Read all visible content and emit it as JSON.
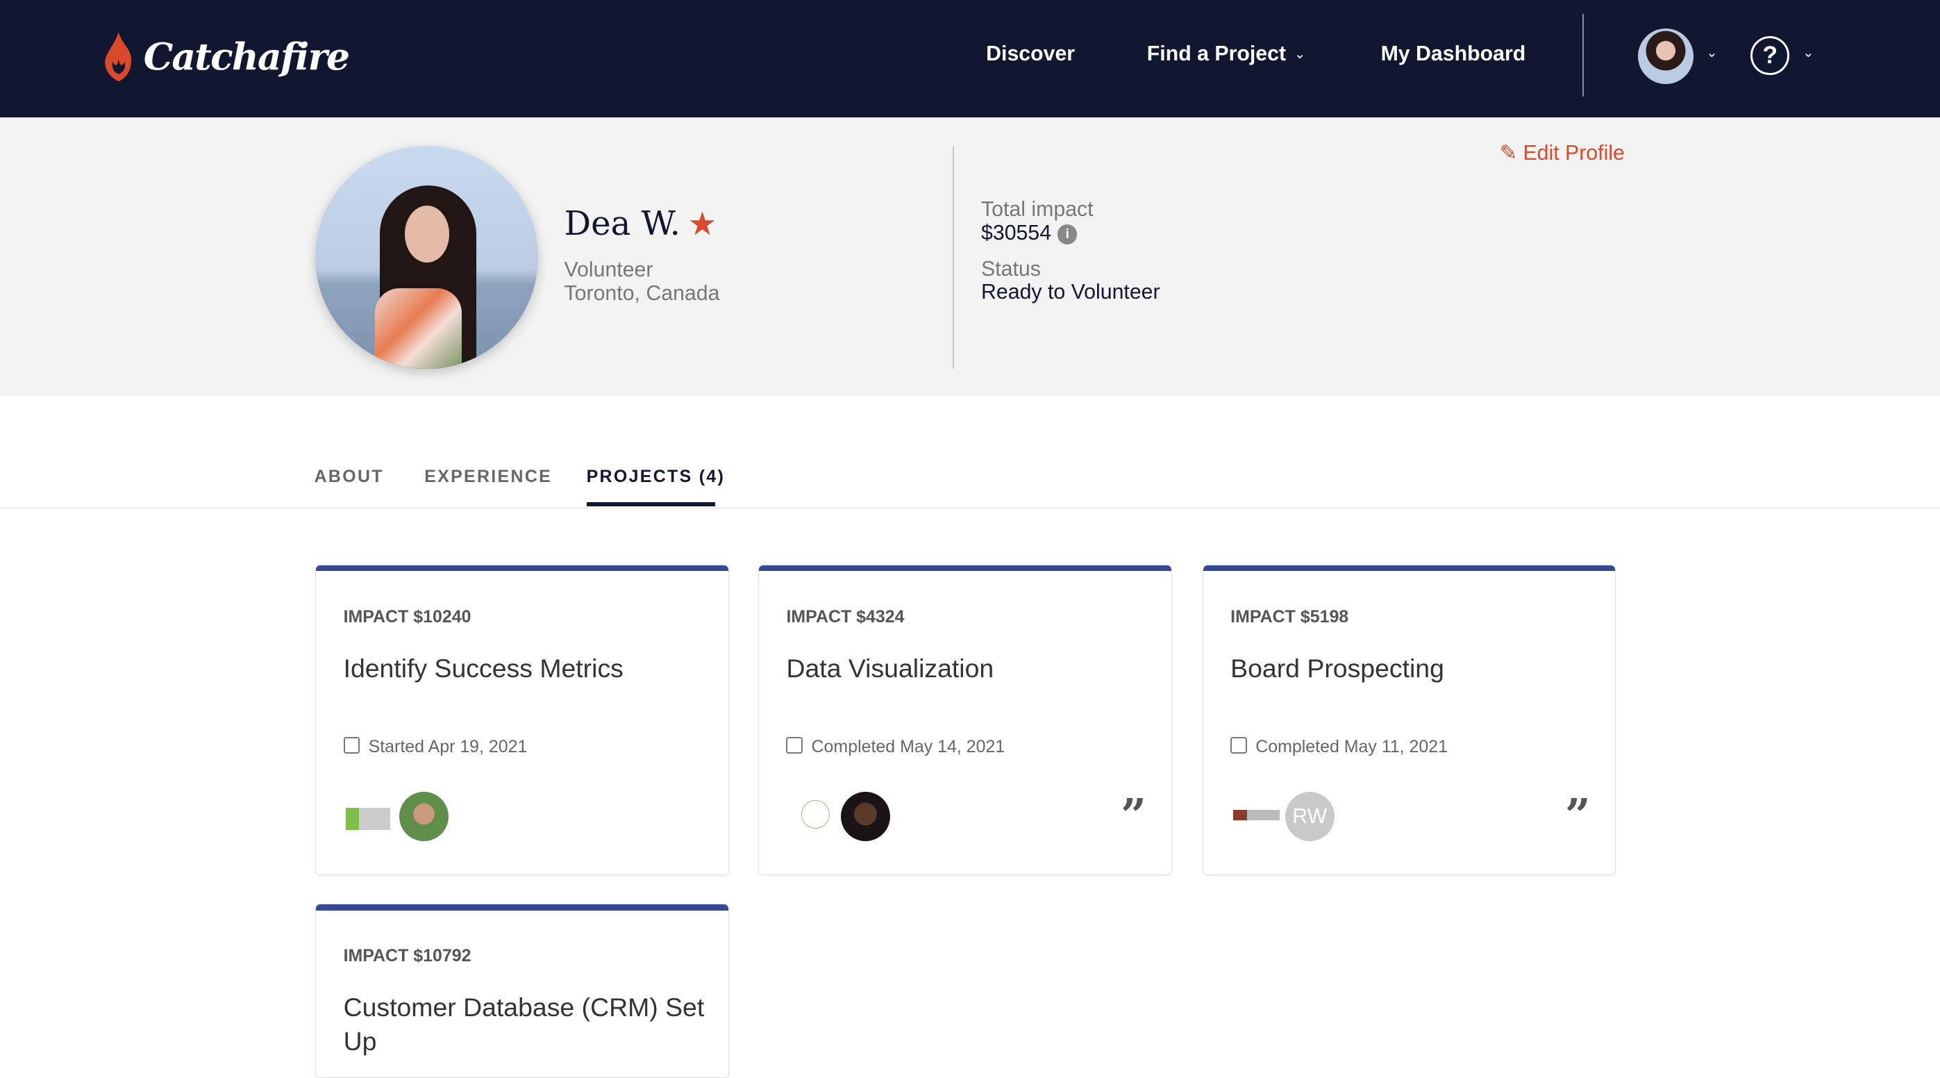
{
  "nav": {
    "logo_text": "Catchafire",
    "links": [
      "Discover",
      "Find a Project",
      "My Dashboard"
    ],
    "help_icon": "?"
  },
  "profile": {
    "name": "Dea W.",
    "role": "Volunteer",
    "location": "Toronto, Canada",
    "total_impact_label": "Total impact",
    "total_impact_value": "$30554",
    "status_label": "Status",
    "status_value": "Ready to Volunteer",
    "edit_label": "Edit Profile"
  },
  "tabs": [
    "ABOUT",
    "EXPERIENCE",
    "PROJECTS (4)"
  ],
  "projects": [
    {
      "impact": "IMPACT $10240",
      "title": "Identify Success Metrics",
      "date": "Started Apr 19, 2021"
    },
    {
      "impact": "IMPACT $4324",
      "title": "Data Visualization",
      "date": "Completed May 14, 2021"
    },
    {
      "impact": "IMPACT $5198",
      "title": "Board Prospecting",
      "date": "Completed May 11, 2021",
      "initials": "RW"
    },
    {
      "impact": "IMPACT $10792",
      "title": "Customer Database (CRM) Set Up"
    }
  ],
  "colors": {
    "nav": "#111631",
    "accent": "#d94a2b",
    "card_bar": "#354a94"
  }
}
